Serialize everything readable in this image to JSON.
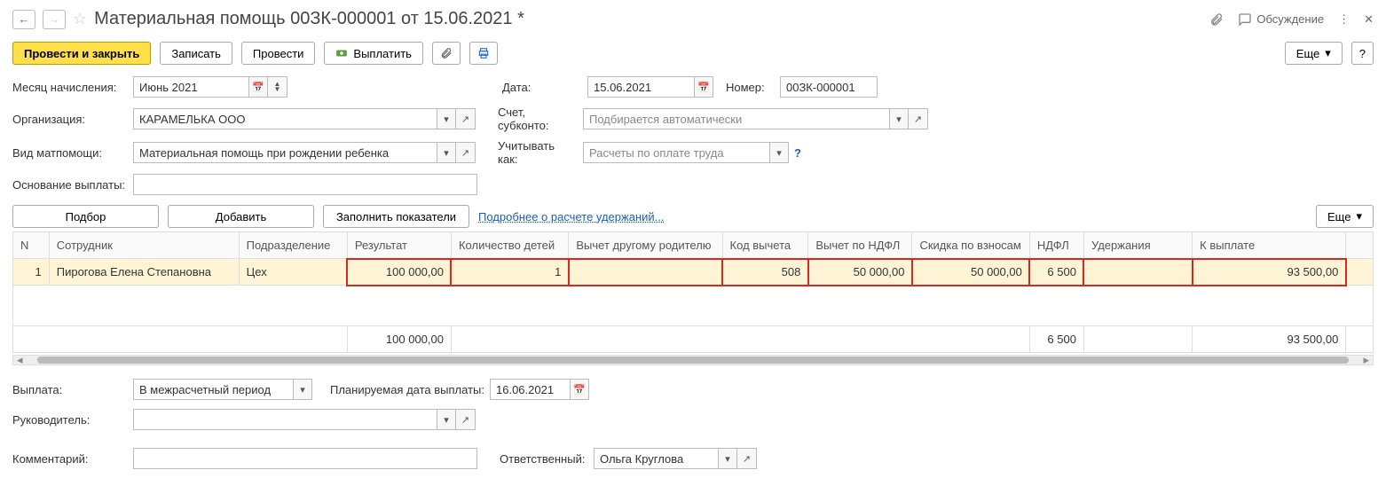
{
  "header": {
    "title": "Материальная помощь 00ЗК-000001 от 15.06.2021 *",
    "discussion": "Обсуждение"
  },
  "toolbar": {
    "post_close": "Провести и закрыть",
    "write": "Записать",
    "post": "Провести",
    "pay": "Выплатить",
    "more": "Еще",
    "help": "?"
  },
  "form": {
    "month_label": "Месяц начисления:",
    "month_value": "Июнь 2021",
    "date_label": "Дата:",
    "date_value": "15.06.2021",
    "number_label": "Номер:",
    "number_value": "00ЗК-000001",
    "org_label": "Организация:",
    "org_value": "КАРАМЕЛЬКА ООО",
    "account_label": "Счет, субконто:",
    "account_placeholder": "Подбирается автоматически",
    "type_label": "Вид матпомощи:",
    "type_value": "Материальная помощь при рождении ребенка",
    "account_as_label": "Учитывать как:",
    "account_as_placeholder": "Расчеты по оплате труда",
    "reason_label": "Основание выплаты:"
  },
  "tbl_toolbar": {
    "select": "Подбор",
    "add": "Добавить",
    "fill": "Заполнить показатели",
    "details_link": "Подробнее о расчете удержаний...",
    "more": "Еще"
  },
  "cols": {
    "n": "N",
    "emp": "Сотрудник",
    "dep": "Подразделение",
    "result": "Результат",
    "children": "Количество детей",
    "other_parent": "Вычет другому родителю",
    "code": "Код вычета",
    "ndfl_ded": "Вычет по НДФЛ",
    "contrib_disc": "Скидка по взносам",
    "ndfl": "НДФЛ",
    "withhold": "Удержания",
    "to_pay": "К выплате"
  },
  "rows": [
    {
      "n": "1",
      "emp": "Пирогова Елена Степановна",
      "dep": "Цех",
      "result": "100 000,00",
      "children": "1",
      "other_parent": "",
      "code": "508",
      "ndfl_ded": "50 000,00",
      "contrib_disc": "50 000,00",
      "ndfl": "6 500",
      "withhold": "",
      "to_pay": "93 500,00"
    }
  ],
  "totals": {
    "result": "100 000,00",
    "ndfl": "6 500",
    "to_pay": "93 500,00"
  },
  "footer": {
    "payment_label": "Выплата:",
    "payment_value": "В межрасчетный период",
    "planned_label": "Планируемая дата выплаты:",
    "planned_value": "16.06.2021",
    "manager_label": "Руководитель:",
    "comment_label": "Комментарий:",
    "responsible_label": "Ответственный:",
    "responsible_value": "Ольга Круглова"
  }
}
